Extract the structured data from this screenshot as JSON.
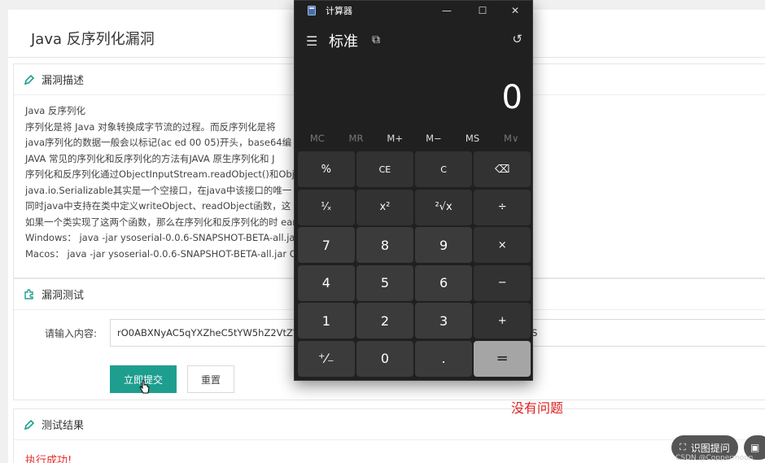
{
  "page": {
    "title": "Java 反序列化漏洞",
    "desc_panel": {
      "heading": "漏洞描述",
      "lines": [
        "Java 反序列化",
        "序列化是将 Java 对象转换成字节流的过程。而反序列化是将",
        "java序列化的数据一般会以标记(ac ed 00 05)开头，base64编",
        "JAVA 常见的序列化和反序列化的方法有JAVA 原生序列化和 J",
        "序列化和反序列化通过ObjectInputStream.readObject()和Obj                                                                    句类如果想要序列化必须实现java.io.Serializable接口",
        "java.io.Serializable其实是一个空接口，在java中该接口的唯一                                                                   反序列化的。",
        "同时java中支持在类中定义writeObject、readObject函数，这                                                                  定的函数",
        "如果一个类实现了这两个函数，那么在序列化和反序列化的时                                                                      eam.writeObject()会主动调用这两个函数。这也是反",
        "Windows：  java -jar ysoserial-0.0.6-SNAPSHOT-BETA-all.ja",
        "Macos：  java -jar ysoserial-0.0.6-SNAPSHOT-BETA-all.jar C"
      ]
    },
    "test_panel": {
      "heading": "漏洞测试",
      "input_label": "请输入内容:",
      "input_value": "rO0ABXNyAC5qYXZheC5tYW5hZ2VtZW                                                                      W9u1Ofaq2MtRkACAAFMAAN2YWx0ABJMamF2YS",
      "submit_label": "立即提交",
      "reset_label": "重置"
    },
    "result_panel": {
      "heading": "测试结果",
      "result_text": "执行成功!"
    },
    "note": "没有问题",
    "ocr_button": "识图提问",
    "watermark": "CSDN @Coppermoon"
  },
  "calculator": {
    "window_title": "计算器",
    "mode": "标准",
    "display": "0",
    "memory": [
      "MC",
      "MR",
      "M+",
      "M−",
      "MS",
      "M∨"
    ],
    "keys": [
      "%",
      "CE",
      "C",
      "⌫",
      "¹⁄ₓ",
      "x²",
      "²√x",
      "÷",
      "7",
      "8",
      "9",
      "×",
      "4",
      "5",
      "6",
      "−",
      "1",
      "2",
      "3",
      "+",
      "⁺⁄₋",
      "0",
      ".",
      "="
    ]
  },
  "colors": {
    "accent": "#1e9e8e",
    "result_red": "#e52b2b",
    "calc_bg": "#202020",
    "equals_key": "#a5a5a5"
  }
}
